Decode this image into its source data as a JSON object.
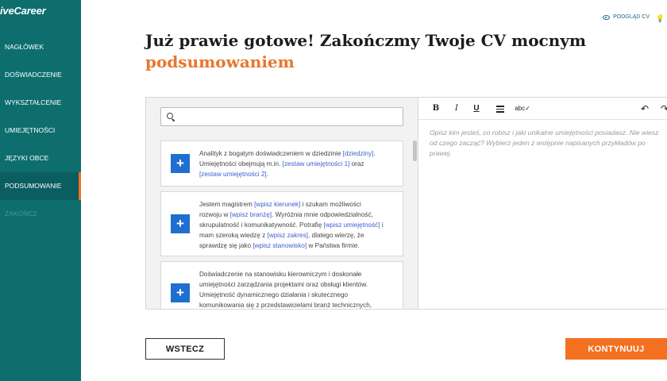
{
  "brand": "iveCareer",
  "sidebar": {
    "items": [
      {
        "label": "NAGŁÓWEK"
      },
      {
        "label": "DOŚWIADCZENIE"
      },
      {
        "label": "WYKSZTAŁCENIE"
      },
      {
        "label": "UMIEJĘTNOŚCI"
      },
      {
        "label": "JĘZYKI OBCE"
      },
      {
        "label": "PODSUMOWANIE",
        "active": true
      },
      {
        "label": "ZAKOŃCZ",
        "disabled": true
      }
    ]
  },
  "header": {
    "preview_label": "PODGLĄD CV",
    "title": "Już prawie gotowe! Zakończmy Twoje CV mocnym",
    "title_accent": "podsumowaniem"
  },
  "search": {
    "placeholder": ""
  },
  "examples": [
    {
      "parts": [
        {
          "t": "Analityk z bogatym doświadczeniem w dziedzinie "
        },
        {
          "t": "[dziedziny]",
          "ph": true
        },
        {
          "t": ". Umiejętności obejmują m.in. "
        },
        {
          "t": "[zestaw umiejętności 1]",
          "ph": true
        },
        {
          "t": " oraz "
        },
        {
          "t": "[zestaw umiejętności 2]",
          "ph": true
        },
        {
          "t": "."
        }
      ]
    },
    {
      "parts": [
        {
          "t": "Jestem magistrem "
        },
        {
          "t": "[wpisz kierunek]",
          "ph": true
        },
        {
          "t": " i szukam możliwości rozwoju w "
        },
        {
          "t": "[wpisz branżę]",
          "ph": true
        },
        {
          "t": ". Wyróżnia mnie odpowiedzialność, skrupulatność i komunikatywność. Potrafię "
        },
        {
          "t": "[wpisz umiejętność]",
          "ph": true
        },
        {
          "t": " i mam szeroką wiedzę z "
        },
        {
          "t": "[wpisz zakres]",
          "ph": true
        },
        {
          "t": ", dlatego wierzę, że sprawdzę się jako "
        },
        {
          "t": "[wpisz stanowisko]",
          "ph": true
        },
        {
          "t": " w Państwa firmie."
        }
      ]
    },
    {
      "parts": [
        {
          "t": "Doświadczenie na stanowisku kierowniczym i doskonałe umiejętności zarządzania projektami oraz obsługi klientów. Umiejętność dynamicznego działania i skutecznego komunikowania się z przedstawicielami branż technicznych,"
        }
      ]
    }
  ],
  "editor": {
    "toolbar": {
      "bold": "B",
      "italic": "I",
      "underline": "U",
      "spellcheck": "abc✓",
      "undo": "↶",
      "redo": "↷"
    },
    "placeholder": "Opisz kim jesteś, co robisz i jaki unikalne umiejętności posiadasz. Nie wiesz od czego zacząć? Wybierz jeden z wstępnie napisanych przykładów po prawej."
  },
  "buttons": {
    "back": "WSTECZ",
    "next": "KONTYNUUJ"
  },
  "colors": {
    "sidebar": "#0e6e6e",
    "accent": "#f37021",
    "plus_button": "#1f6fd1",
    "placeholder_link": "#3a5fcd"
  }
}
